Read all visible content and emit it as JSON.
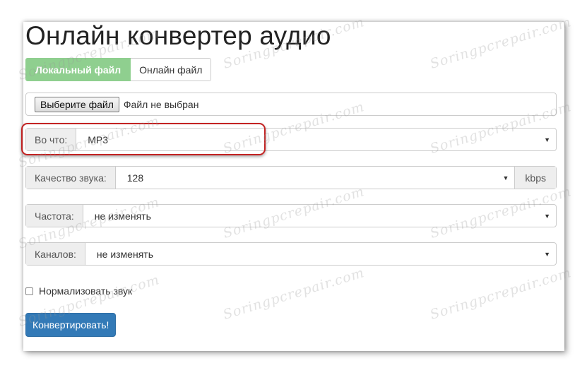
{
  "page": {
    "title": "Онлайн конвертер аудио"
  },
  "tabs": [
    {
      "label": "Локальный файл",
      "active": true
    },
    {
      "label": "Онлайн файл",
      "active": false
    }
  ],
  "file_input": {
    "button_label": "Выберите файл",
    "status_text": "Файл не выбран"
  },
  "format": {
    "label": "Во что:",
    "value": "MP3"
  },
  "quality": {
    "label": "Качество звука:",
    "value": "128",
    "unit": "kbps"
  },
  "frequency": {
    "label": "Частота:",
    "value": "не изменять"
  },
  "channels": {
    "label": "Каналов:",
    "value": "не изменять"
  },
  "normalize": {
    "label": "Нормализовать звук",
    "checked": false
  },
  "convert_button": {
    "label": "Конвертировать!"
  },
  "watermark": {
    "text": "Soringpcrepair.com"
  },
  "colors": {
    "active_tab": "#8fcf8f",
    "primary_button": "#337ab7",
    "highlight": "#c32222"
  }
}
